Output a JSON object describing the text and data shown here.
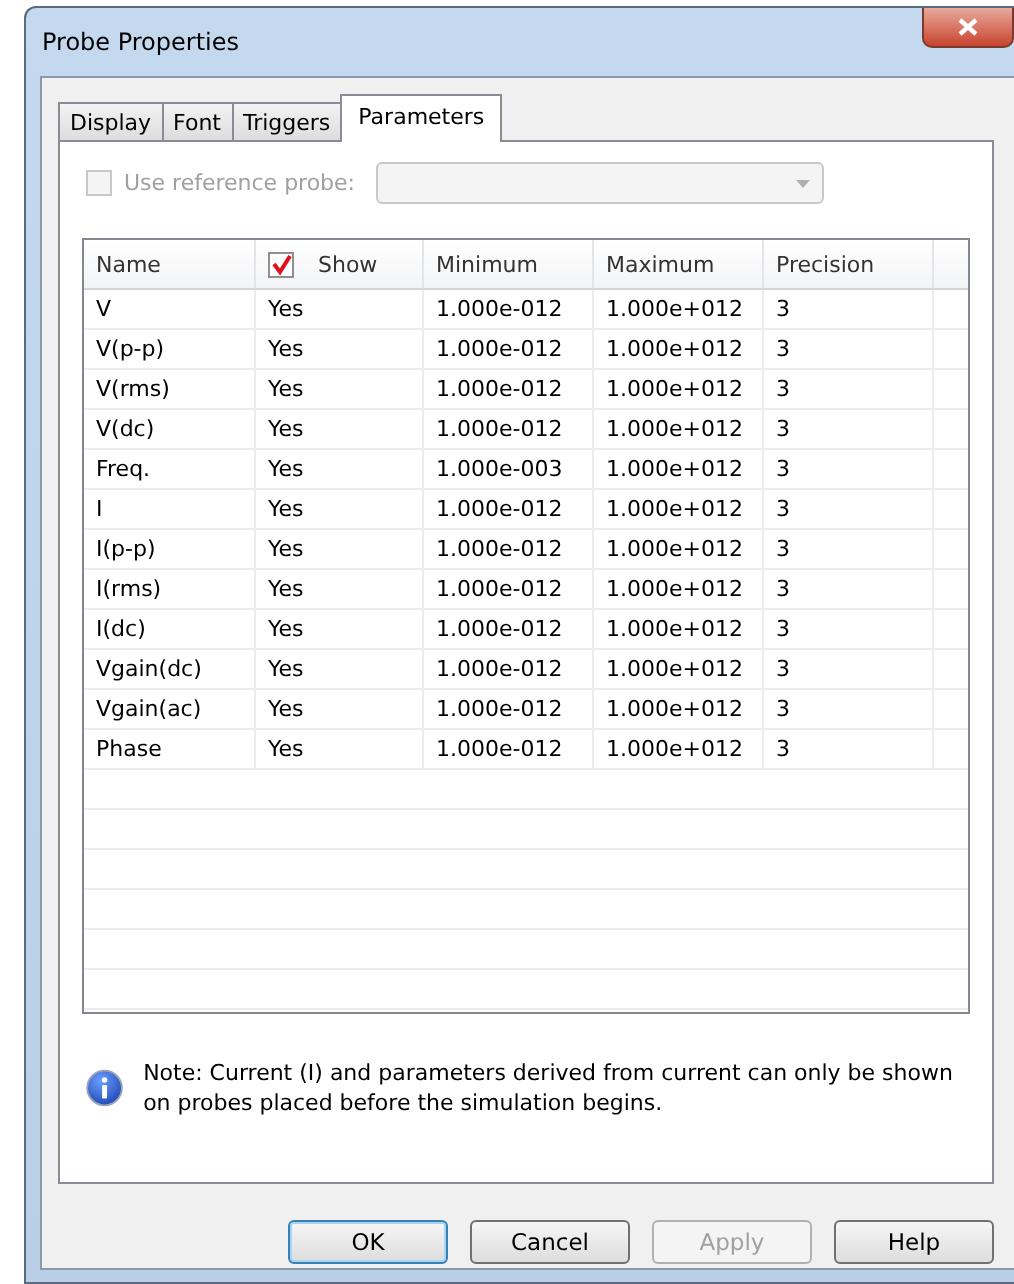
{
  "window": {
    "title": "Probe Properties"
  },
  "tabs": [
    {
      "label": "Display",
      "selected": false
    },
    {
      "label": "Font",
      "selected": false
    },
    {
      "label": "Triggers",
      "selected": false
    },
    {
      "label": "Parameters",
      "selected": true
    }
  ],
  "reference_probe": {
    "label": "Use reference probe:",
    "checked": false,
    "disabled": true
  },
  "table": {
    "columns": [
      "Name",
      "Show",
      "Minimum",
      "Maximum",
      "Precision"
    ],
    "show_all_checked": true,
    "rows": [
      {
        "name": "V",
        "show": "Yes",
        "minimum": "1.000e-012",
        "maximum": "1.000e+012",
        "precision": "3"
      },
      {
        "name": "V(p-p)",
        "show": "Yes",
        "minimum": "1.000e-012",
        "maximum": "1.000e+012",
        "precision": "3"
      },
      {
        "name": "V(rms)",
        "show": "Yes",
        "minimum": "1.000e-012",
        "maximum": "1.000e+012",
        "precision": "3"
      },
      {
        "name": "V(dc)",
        "show": "Yes",
        "minimum": "1.000e-012",
        "maximum": "1.000e+012",
        "precision": "3"
      },
      {
        "name": "Freq.",
        "show": "Yes",
        "minimum": "1.000e-003",
        "maximum": "1.000e+012",
        "precision": "3"
      },
      {
        "name": "I",
        "show": "Yes",
        "minimum": "1.000e-012",
        "maximum": "1.000e+012",
        "precision": "3"
      },
      {
        "name": "I(p-p)",
        "show": "Yes",
        "minimum": "1.000e-012",
        "maximum": "1.000e+012",
        "precision": "3"
      },
      {
        "name": "I(rms)",
        "show": "Yes",
        "minimum": "1.000e-012",
        "maximum": "1.000e+012",
        "precision": "3"
      },
      {
        "name": "I(dc)",
        "show": "Yes",
        "minimum": "1.000e-012",
        "maximum": "1.000e+012",
        "precision": "3"
      },
      {
        "name": "Vgain(dc)",
        "show": "Yes",
        "minimum": "1.000e-012",
        "maximum": "1.000e+012",
        "precision": "3"
      },
      {
        "name": "Vgain(ac)",
        "show": "Yes",
        "minimum": "1.000e-012",
        "maximum": "1.000e+012",
        "precision": "3"
      },
      {
        "name": "Phase",
        "show": "Yes",
        "minimum": "1.000e-012",
        "maximum": "1.000e+012",
        "precision": "3"
      }
    ]
  },
  "note": "Note: Current (I) and parameters derived from current can only be shown on probes placed before the simulation begins.",
  "buttons": [
    {
      "label": "OK",
      "default": true,
      "disabled": false
    },
    {
      "label": "Cancel",
      "default": false,
      "disabled": false
    },
    {
      "label": "Apply",
      "default": false,
      "disabled": true
    },
    {
      "label": "Help",
      "default": false,
      "disabled": false
    }
  ]
}
